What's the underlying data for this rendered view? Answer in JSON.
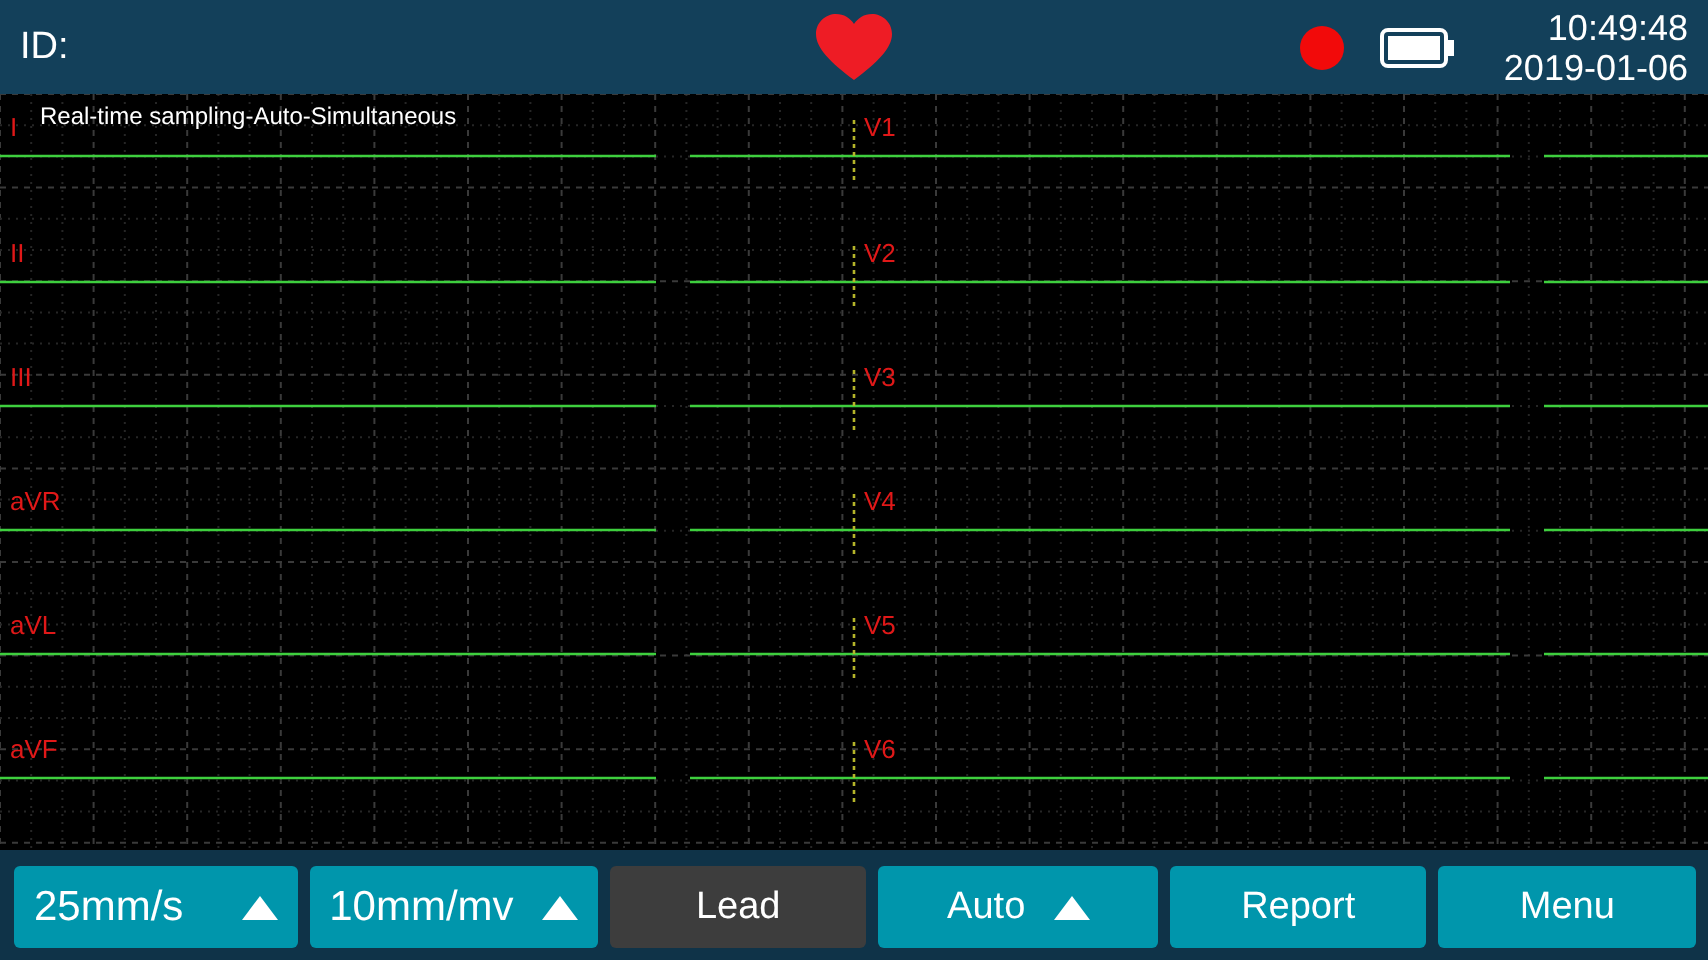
{
  "header": {
    "id_label": "ID:",
    "time": "10:49:48",
    "date": "2019-01-06"
  },
  "chart": {
    "mode": "Real-time sampling-Auto-Simultaneous",
    "left_leads": [
      "I",
      "II",
      "III",
      "aVR",
      "aVL",
      "aVF"
    ],
    "right_leads": [
      "V1",
      "V2",
      "V3",
      "V4",
      "V5",
      "V6"
    ]
  },
  "buttons": [
    {
      "label": "25mm/s",
      "kind": "dropdown",
      "disabled": false
    },
    {
      "label": "10mm/mv",
      "kind": "dropdown",
      "disabled": false
    },
    {
      "label": "Lead",
      "kind": "plain",
      "disabled": true
    },
    {
      "label": "Auto",
      "kind": "dropdown",
      "disabled": false
    },
    {
      "label": "Report",
      "kind": "plain",
      "disabled": false
    },
    {
      "label": "Menu",
      "kind": "plain",
      "disabled": false
    }
  ]
}
